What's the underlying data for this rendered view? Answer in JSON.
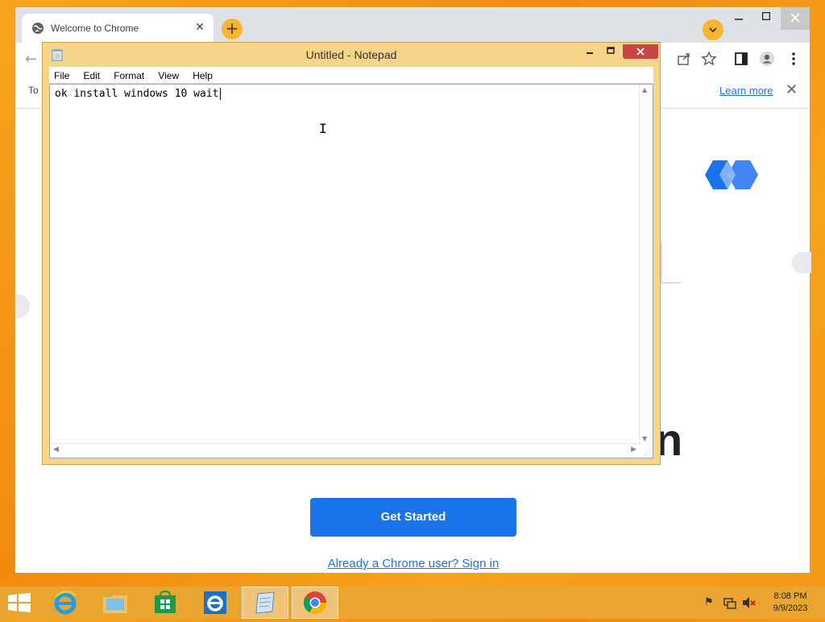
{
  "chrome": {
    "tab_title": "Welcome to Chrome",
    "tab_close": "✕",
    "new_tab": "+",
    "infobar_text": "To",
    "learn_more": "Learn more",
    "infobar_close": "✕",
    "big_text_fragment": "n",
    "get_started": "Get Started",
    "sign_in": "Already a Chrome user? Sign in",
    "accent": "#1a73e8"
  },
  "notepad": {
    "title": "Untitled - Notepad",
    "menu": [
      "File",
      "Edit",
      "Format",
      "View",
      "Help"
    ],
    "content": "ok install windows 10 wait"
  },
  "taskbar": {
    "time": "8:08 PM",
    "date": "9/9/2023",
    "apps": [
      "internet-explorer",
      "file-explorer",
      "store",
      "ie-alt",
      "notepad",
      "chrome"
    ]
  }
}
